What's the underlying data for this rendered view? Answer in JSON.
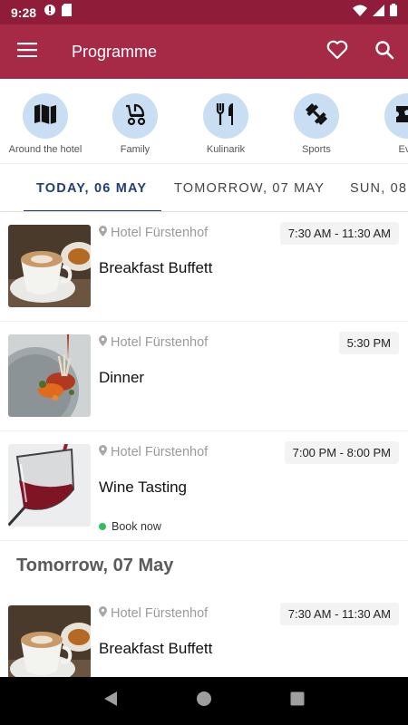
{
  "status_bar": {
    "time": "9:28",
    "left_icons": [
      "warning-icon",
      "sd-card-icon"
    ],
    "right_icons": [
      "wifi-icon",
      "cellular-icon",
      "battery-icon"
    ]
  },
  "app_bar": {
    "title": "Programme",
    "color": "#a62a46",
    "actions": [
      "heart-icon",
      "search-icon"
    ]
  },
  "categories": [
    {
      "label": "Around the hotel",
      "icon": "map-icon"
    },
    {
      "label": "Family",
      "icon": "stroller-icon"
    },
    {
      "label": "Kulinarik",
      "icon": "cutlery-icon"
    },
    {
      "label": "Sports",
      "icon": "dumbbell-icon"
    },
    {
      "label": "Eve",
      "icon": "ticket-icon"
    }
  ],
  "date_tabs": [
    {
      "label": "TODAY, 06 MAY",
      "active": true
    },
    {
      "label": "TOMORROW, 07 MAY",
      "active": false
    },
    {
      "label": "SUN, 08",
      "active": false
    }
  ],
  "events_today": [
    {
      "location": "Hotel Fürstenhof",
      "time": "7:30 AM - 11:30 AM",
      "title": "Breakfast Buffett",
      "image": "coffee-cup-photo"
    },
    {
      "location": "Hotel Fürstenhof",
      "time": "5:30 PM",
      "title": "Dinner",
      "image": "plated-dish-photo"
    },
    {
      "location": "Hotel Fürstenhof",
      "time": "7:00 PM - 8:00 PM",
      "title": "Wine Tasting",
      "image": "wine-glass-photo",
      "action": "Book now"
    }
  ],
  "section_tomorrow": {
    "heading": "Tomorrow, 07 May"
  },
  "events_tomorrow": [
    {
      "location": "Hotel Fürstenhof",
      "time": "7:30 AM - 11:30 AM",
      "title": "Breakfast Buffett",
      "image": "coffee-cup-photo"
    }
  ],
  "nav_bar": [
    "back-icon",
    "home-icon",
    "recents-icon"
  ]
}
